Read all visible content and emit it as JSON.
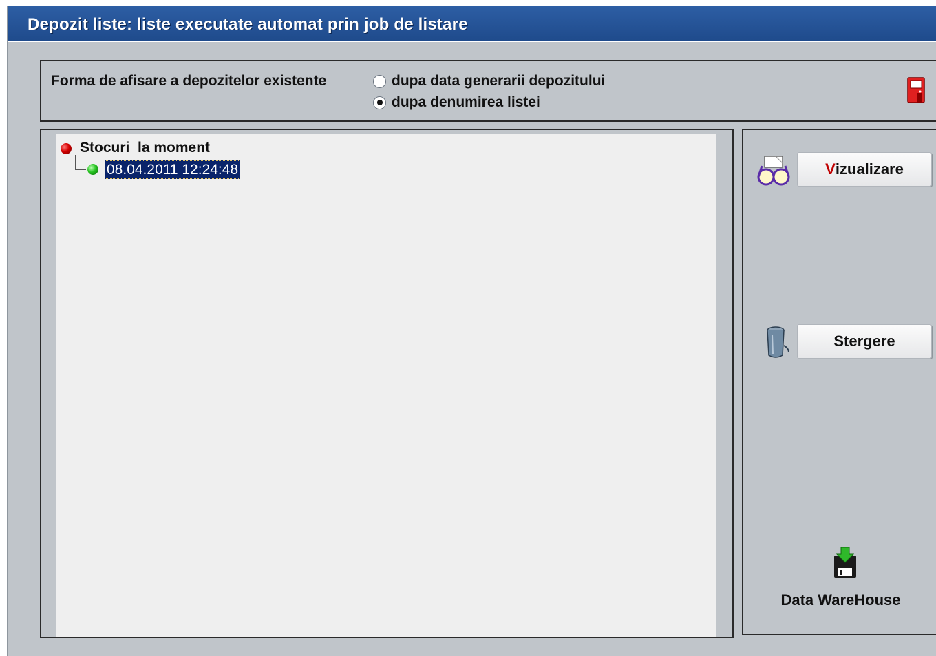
{
  "window": {
    "title": "Depozit liste: liste executate automat prin job de listare"
  },
  "display_options": {
    "label": "Forma de afisare a depozitelor existente",
    "radios": [
      {
        "label": "dupa data generarii depozitului",
        "checked": false
      },
      {
        "label": "dupa denumirea listei",
        "checked": true
      }
    ]
  },
  "tree": {
    "root": {
      "label": "Stocuri  la moment",
      "status_color": "#d40000"
    },
    "children": [
      {
        "label": "08.04.2011 12:24:48",
        "selected": true,
        "status_color": "#25c21f"
      }
    ]
  },
  "actions": {
    "view_accent": "V",
    "view_rest": "izualizare",
    "delete_label": "Stergere",
    "datawarehouse_label": "Data WareHouse"
  },
  "icons": {
    "exit": "exit-door-icon",
    "view": "glasses-icon",
    "delete": "trash-can-icon",
    "datawarehouse": "floppy-save-icon"
  }
}
